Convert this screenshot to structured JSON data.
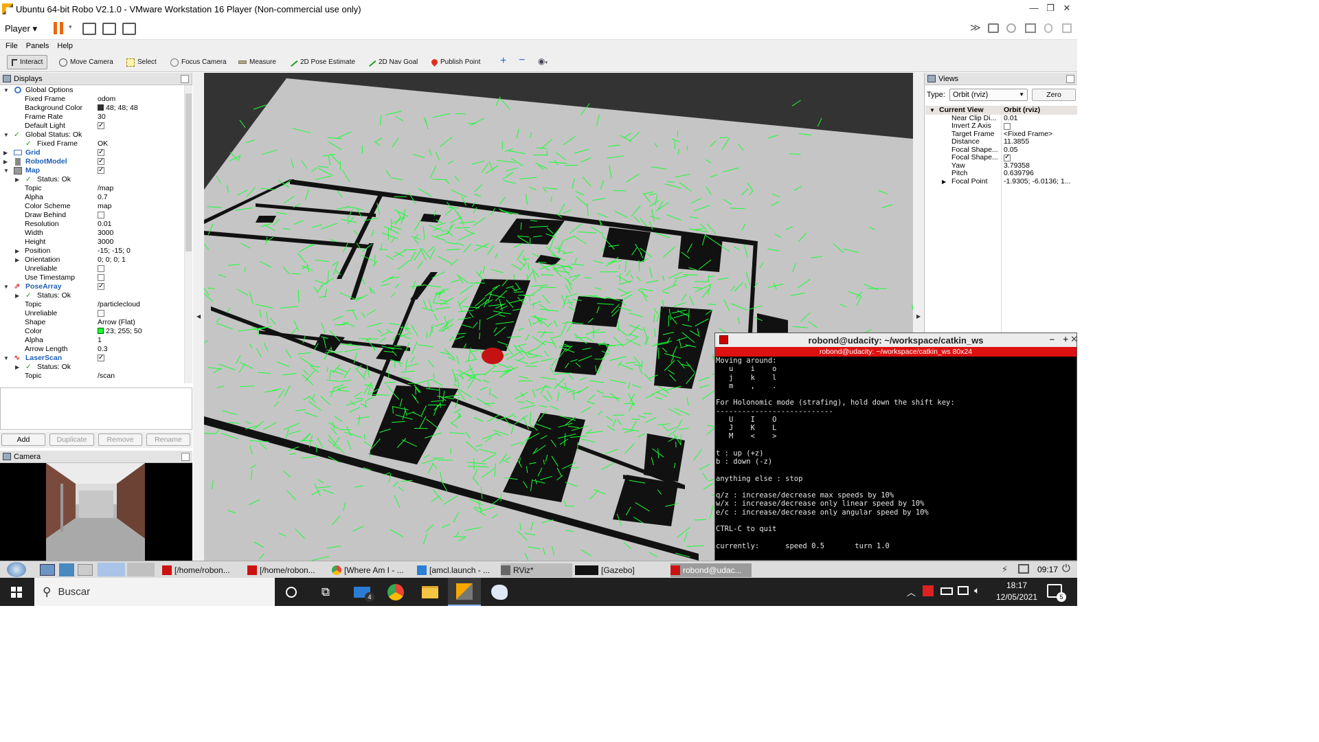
{
  "window": {
    "title": "Ubuntu 64-bit Robo V2.1.0 - VMware Workstation 16 Player (Non-commercial use only)"
  },
  "player_menu": {
    "label": "Player"
  },
  "rviz_menu": [
    "File",
    "Panels",
    "Help"
  ],
  "tools": [
    {
      "label": "Interact",
      "icon": "cursor-icon",
      "active": true
    },
    {
      "label": "Move Camera",
      "icon": "move-icon"
    },
    {
      "label": "Select",
      "icon": "select-icon"
    },
    {
      "label": "Focus Camera",
      "icon": "focus-icon"
    },
    {
      "label": "Measure",
      "icon": "ruler-icon"
    },
    {
      "label": "2D Pose Estimate",
      "icon": "green-arrow-icon"
    },
    {
      "label": "2D Nav Goal",
      "icon": "green-arrow-icon"
    },
    {
      "label": "Publish Point",
      "icon": "pin-icon"
    }
  ],
  "displays": {
    "title": "Displays",
    "rows": [
      {
        "name": "Global Options",
        "value": ""
      },
      {
        "name": "Fixed Frame",
        "value": "odom"
      },
      {
        "name": "Background Color",
        "value": "48; 48; 48"
      },
      {
        "name": "Frame Rate",
        "value": "30"
      },
      {
        "name": "Default Light",
        "value": ""
      },
      {
        "name": "Global Status: Ok",
        "value": ""
      },
      {
        "name": "Fixed Frame",
        "value": "OK"
      },
      {
        "name": "Grid",
        "value": ""
      },
      {
        "name": "RobotModel",
        "value": ""
      },
      {
        "name": "Map",
        "value": ""
      },
      {
        "name": "Status: Ok",
        "value": ""
      },
      {
        "name": "Topic",
        "value": "/map"
      },
      {
        "name": "Alpha",
        "value": "0.7"
      },
      {
        "name": "Color Scheme",
        "value": "map"
      },
      {
        "name": "Draw Behind",
        "value": ""
      },
      {
        "name": "Resolution",
        "value": "0.01"
      },
      {
        "name": "Width",
        "value": "3000"
      },
      {
        "name": "Height",
        "value": "3000"
      },
      {
        "name": "Position",
        "value": "-15; -15; 0"
      },
      {
        "name": "Orientation",
        "value": "0; 0; 0; 1"
      },
      {
        "name": "Unreliable",
        "value": ""
      },
      {
        "name": "Use Timestamp",
        "value": ""
      },
      {
        "name": "PoseArray",
        "value": ""
      },
      {
        "name": "Status: Ok",
        "value": ""
      },
      {
        "name": "Topic",
        "value": "/particlecloud"
      },
      {
        "name": "Unreliable",
        "value": ""
      },
      {
        "name": "Shape",
        "value": "Arrow (Flat)"
      },
      {
        "name": "Color",
        "value": "23; 255; 50"
      },
      {
        "name": "Alpha",
        "value": "1"
      },
      {
        "name": "Arrow Length",
        "value": "0.3"
      },
      {
        "name": "LaserScan",
        "value": ""
      },
      {
        "name": "Status: Ok",
        "value": ""
      },
      {
        "name": "Topic",
        "value": "/scan"
      }
    ],
    "buttons": [
      "Add",
      "Duplicate",
      "Remove",
      "Rename"
    ]
  },
  "camera_panel": {
    "title": "Camera"
  },
  "views": {
    "title": "Views",
    "type_label": "Type:",
    "type_value": "Orbit (rviz)",
    "zero_label": "Zero",
    "header": {
      "name": "Current View",
      "value": "Orbit (rviz)"
    },
    "rows": [
      {
        "name": "Near Clip Di...",
        "value": "0.01"
      },
      {
        "name": "Invert Z Axis",
        "value": ""
      },
      {
        "name": "Target Frame",
        "value": "<Fixed Frame>"
      },
      {
        "name": "Distance",
        "value": "11.3855"
      },
      {
        "name": "Focal Shape...",
        "value": "0.05"
      },
      {
        "name": "Focal Shape...",
        "value": ""
      },
      {
        "name": "Yaw",
        "value": "3.79358"
      },
      {
        "name": "Pitch",
        "value": "0.639796"
      },
      {
        "name": "Focal Point",
        "value": "-1.9305; -6.0136; 1..."
      }
    ]
  },
  "terminal": {
    "title": "robond@udacity: ~/workspace/catkin_ws",
    "subtitle": "robond@udacity: ~/workspace/catkin_ws 80x24",
    "lines": [
      "Moving around:",
      "   u    i    o",
      "   j    k    l",
      "   m    ,    .",
      "",
      "For Holonomic mode (strafing), hold down the shift key:",
      "---------------------------",
      "   U    I    O",
      "   J    K    L",
      "   M    <    >",
      "",
      "t : up (+z)",
      "b : down (-z)",
      "",
      "anything else : stop",
      "",
      "q/z : increase/decrease max speeds by 10%",
      "w/x : increase/decrease only linear speed by 10%",
      "e/c : increase/decrease only angular speed by 10%",
      "",
      "CTRL-C to quit",
      "",
      "currently:      speed 0.5       turn 1.0"
    ]
  },
  "guest_taskbar": {
    "tasks": [
      {
        "label": "[/home/robon...",
        "icon": "terminal-icon"
      },
      {
        "label": "[/home/robon...",
        "icon": "terminal-icon"
      },
      {
        "label": "[Where Am I - ...",
        "icon": "chrome-icon"
      },
      {
        "label": "[amcl.launch - ...",
        "icon": "vscode-icon"
      },
      {
        "label": "RViz*",
        "icon": "rviz-icon"
      },
      {
        "label": "[Gazebo]",
        "icon": "rviz-icon"
      },
      {
        "label": "robond@udac...",
        "icon": "terminal-icon"
      }
    ],
    "time": "09:17"
  },
  "windows_taskbar": {
    "search_placeholder": "Buscar",
    "mail_badge": "4",
    "time": "18:17",
    "date": "12/05/2021",
    "notif_count": "5"
  },
  "colors": {
    "particle": "#17ff32",
    "map_floor": "#c4c4c4",
    "rviz_bg": "#303030",
    "terminal_red": "#dd1111"
  }
}
